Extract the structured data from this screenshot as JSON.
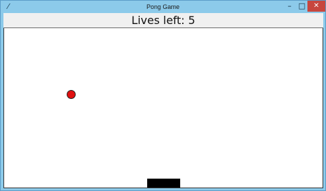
{
  "window": {
    "title": "Pong Game",
    "app_icon": "feather-icon",
    "controls": {
      "minimize_icon": "minimize-icon",
      "maximize_icon": "maximize-icon",
      "close_icon": "close-icon",
      "close_color": "#c7463e"
    }
  },
  "game": {
    "lives_text": "Lives left: 5",
    "ball_color": "#e01010",
    "paddle_color": "#000000",
    "background_color": "#ffffff"
  }
}
